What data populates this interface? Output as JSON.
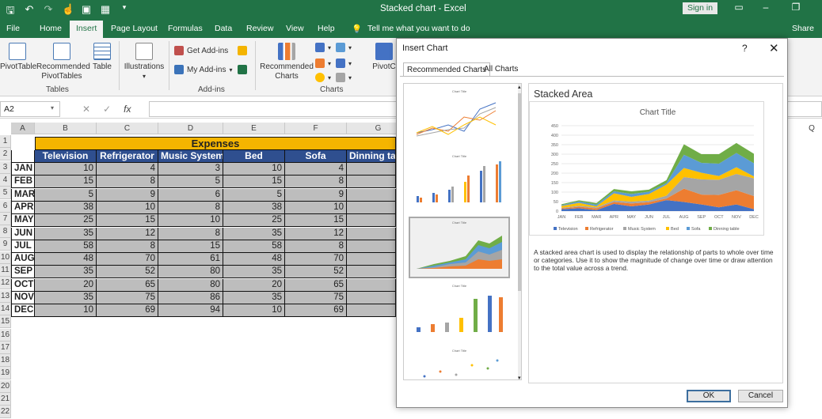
{
  "app": {
    "title": "Stacked chart - Excel",
    "signin": "Sign in"
  },
  "tabs": [
    "File",
    "Home",
    "Insert",
    "Page Layout",
    "Formulas",
    "Data",
    "Review",
    "View",
    "Help"
  ],
  "tellme": "Tell me what you want to do",
  "share": "Share",
  "ribbon": {
    "pivottable": "PivotTable",
    "recommended_pivot_1": "Recommended",
    "recommended_pivot_2": "PivotTables",
    "table": "Table",
    "tables_group": "Tables",
    "illustrations": "Illustrations",
    "get_addins": "Get Add-ins",
    "my_addins": "My Add-ins",
    "addins_group": "Add-ins",
    "recommended_charts_1": "Recommended",
    "recommended_charts_2": "Charts",
    "charts_group": "Charts",
    "pivotchart": "PivotC"
  },
  "formula_bar": {
    "name_box": "A2",
    "fx": "fx"
  },
  "sheet": {
    "columns": [
      "A",
      "B",
      "C",
      "D",
      "E",
      "F",
      "G"
    ],
    "title": "Expenses",
    "headers": [
      "Television",
      "Refrigerator",
      "Music System",
      "Bed",
      "Sofa",
      "Dinning table"
    ],
    "rows": [
      {
        "month": "JAN",
        "vals": [
          10,
          4,
          3,
          10,
          4
        ]
      },
      {
        "month": "FEB",
        "vals": [
          15,
          8,
          5,
          15,
          8
        ]
      },
      {
        "month": "MAR",
        "vals": [
          5,
          9,
          6,
          5,
          9
        ]
      },
      {
        "month": "APR",
        "vals": [
          38,
          10,
          8,
          38,
          10
        ]
      },
      {
        "month": "MAY",
        "vals": [
          25,
          15,
          10,
          25,
          15
        ]
      },
      {
        "month": "JUN",
        "vals": [
          35,
          12,
          8,
          35,
          12
        ]
      },
      {
        "month": "JUL",
        "vals": [
          58,
          8,
          15,
          58,
          8
        ]
      },
      {
        "month": "AUG",
        "vals": [
          48,
          70,
          61,
          48,
          70
        ]
      },
      {
        "month": "SEP",
        "vals": [
          35,
          52,
          80,
          35,
          52
        ]
      },
      {
        "month": "OCT",
        "vals": [
          20,
          65,
          80,
          20,
          65
        ]
      },
      {
        "month": "NOV",
        "vals": [
          35,
          75,
          86,
          35,
          75
        ]
      },
      {
        "month": "DEC",
        "vals": [
          10,
          69,
          94,
          10,
          69
        ]
      }
    ],
    "row_numbers": [
      "1",
      "2",
      "3",
      "4",
      "5",
      "6",
      "7",
      "8",
      "9",
      "10",
      "11",
      "12",
      "13",
      "14",
      "15",
      "16",
      "17",
      "18",
      "19",
      "20",
      "21",
      "22"
    ],
    "extra_col": "Q"
  },
  "dialog": {
    "title": "Insert Chart",
    "help": "?",
    "close": "✕",
    "tab_recommended": "Recommended Charts",
    "tab_all": "All Charts",
    "thumb_title": "Chart Title",
    "chart_type_name": "Stacked Area",
    "description": "A stacked area chart is used to display the relationship of parts to whole over time or categories. Use it to show the magnitude of change over time or draw attention to the total value across a trend.",
    "ok": "OK",
    "cancel": "Cancel"
  },
  "colors": {
    "Television": "#4472c4",
    "Refrigerator": "#ed7d31",
    "Music System": "#a5a5a5",
    "Bed": "#ffc000",
    "Sofa": "#5b9bd5",
    "Dinning table": "#70ad47"
  },
  "chart_data": {
    "type": "area",
    "title": "Chart Title",
    "categories": [
      "JAN",
      "FEB",
      "MAR",
      "APR",
      "MAY",
      "JUN",
      "JUL",
      "AUG",
      "SEP",
      "OCT",
      "NOV",
      "DEC"
    ],
    "series": [
      {
        "name": "Television",
        "values": [
          10,
          15,
          5,
          38,
          25,
          35,
          58,
          48,
          35,
          20,
          35,
          10
        ]
      },
      {
        "name": "Refrigerator",
        "values": [
          4,
          8,
          9,
          10,
          15,
          12,
          8,
          70,
          52,
          65,
          75,
          69
        ]
      },
      {
        "name": "Music System",
        "values": [
          3,
          5,
          6,
          8,
          10,
          8,
          15,
          61,
          80,
          80,
          86,
          94
        ]
      },
      {
        "name": "Bed",
        "values": [
          10,
          15,
          5,
          38,
          25,
          35,
          58,
          48,
          35,
          20,
          35,
          10
        ]
      },
      {
        "name": "Sofa",
        "values": [
          4,
          8,
          9,
          10,
          15,
          12,
          8,
          70,
          52,
          65,
          75,
          69
        ]
      },
      {
        "name": "Dinning table",
        "values": [
          5,
          6,
          8,
          12,
          14,
          11,
          16,
          55,
          46,
          50,
          53,
          50
        ]
      }
    ],
    "ylim": [
      0,
      450
    ],
    "yticks": [
      0,
      50,
      100,
      150,
      200,
      250,
      300,
      350,
      400,
      450
    ],
    "legend": "bottom",
    "grid": true
  }
}
